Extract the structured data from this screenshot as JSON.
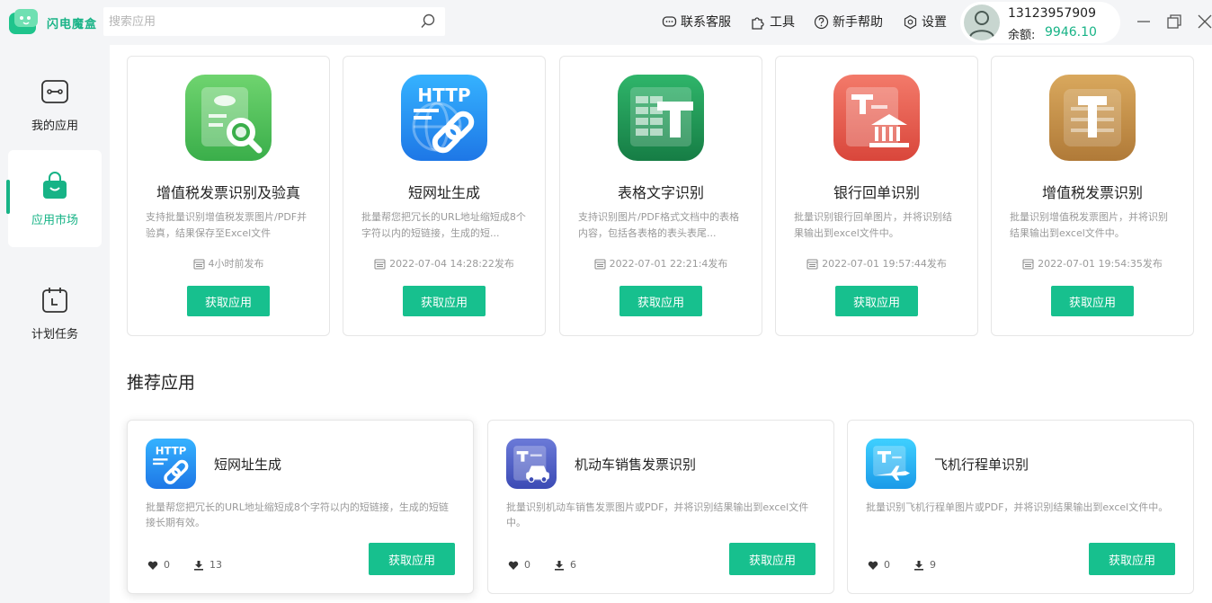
{
  "header": {
    "logo_text": "闪电魔盒",
    "search_placeholder": "搜索应用",
    "nav": {
      "support": "联系客服",
      "tools": "工具",
      "help": "新手帮助",
      "settings": "设置"
    },
    "user": {
      "phone": "13123957909",
      "balance_label": "余额:",
      "balance": "9946.10"
    }
  },
  "sidebar": {
    "items": [
      {
        "label": "我的应用",
        "icon": "apps-icon"
      },
      {
        "label": "应用市场",
        "icon": "shopping-bag-icon",
        "active": true
      },
      {
        "label": "计划任务",
        "icon": "calendar-icon"
      }
    ]
  },
  "apps": [
    {
      "title": "增值税发票识别及验真",
      "desc": "支持批量识别增值税发票图片/PDF并验真，结果保存至Excel文件",
      "date": "4小时前发布",
      "button": "获取应用",
      "icon": "invoice-verify-icon",
      "color": "#4cc25c"
    },
    {
      "title": "短网址生成",
      "desc": "批量帮您把冗长的URL地址缩短成8个字符以内的短链接，生成的短...",
      "date": "2022-07-04 14:28:22发布",
      "button": "获取应用",
      "icon": "http-link-icon",
      "color": "#2e8ff0"
    },
    {
      "title": "表格文字识别",
      "desc": "支持识别图片/PDF格式文档中的表格内容，包括各表格的表头表尾...",
      "date": "2022-07-01 22:21:4发布",
      "button": "获取应用",
      "icon": "table-text-icon",
      "color": "#1d9e5a"
    },
    {
      "title": "银行回单识别",
      "desc": "批量识别银行回单图片，并将识别结果输出到excel文件中。",
      "date": "2022-07-01 19:57:44发布",
      "button": "获取应用",
      "icon": "bank-receipt-icon",
      "color": "#e25a4e"
    },
    {
      "title": "增值税发票识别",
      "desc": "批量识别增值税发票图片，并将识别结果输出到excel文件中。",
      "date": "2022-07-01 19:54:35发布",
      "button": "获取应用",
      "icon": "tax-invoice-icon",
      "color": "#c9954a"
    }
  ],
  "recommended": {
    "title": "推荐应用",
    "items": [
      {
        "title": "短网址生成",
        "desc": "批量帮您把冗长的URL地址缩短成8个字符以内的短链接，生成的短链接长期有效。",
        "likes": "0",
        "downloads": "13",
        "button": "获取应用",
        "icon": "http-link-icon"
      },
      {
        "title": "机动车销售发票识别",
        "desc": "批量识别机动车销售发票图片或PDF，并将识别结果输出到excel文件中。",
        "likes": "0",
        "downloads": "6",
        "button": "获取应用",
        "icon": "car-invoice-icon"
      },
      {
        "title": "飞机行程单识别",
        "desc": "批量识别飞机行程单图片或PDF，并将识别结果输出到excel文件中。",
        "likes": "0",
        "downloads": "9",
        "button": "获取应用",
        "icon": "flight-itinerary-icon"
      }
    ]
  },
  "colors": {
    "accent": "#17c08e",
    "balance": "#17b386"
  }
}
